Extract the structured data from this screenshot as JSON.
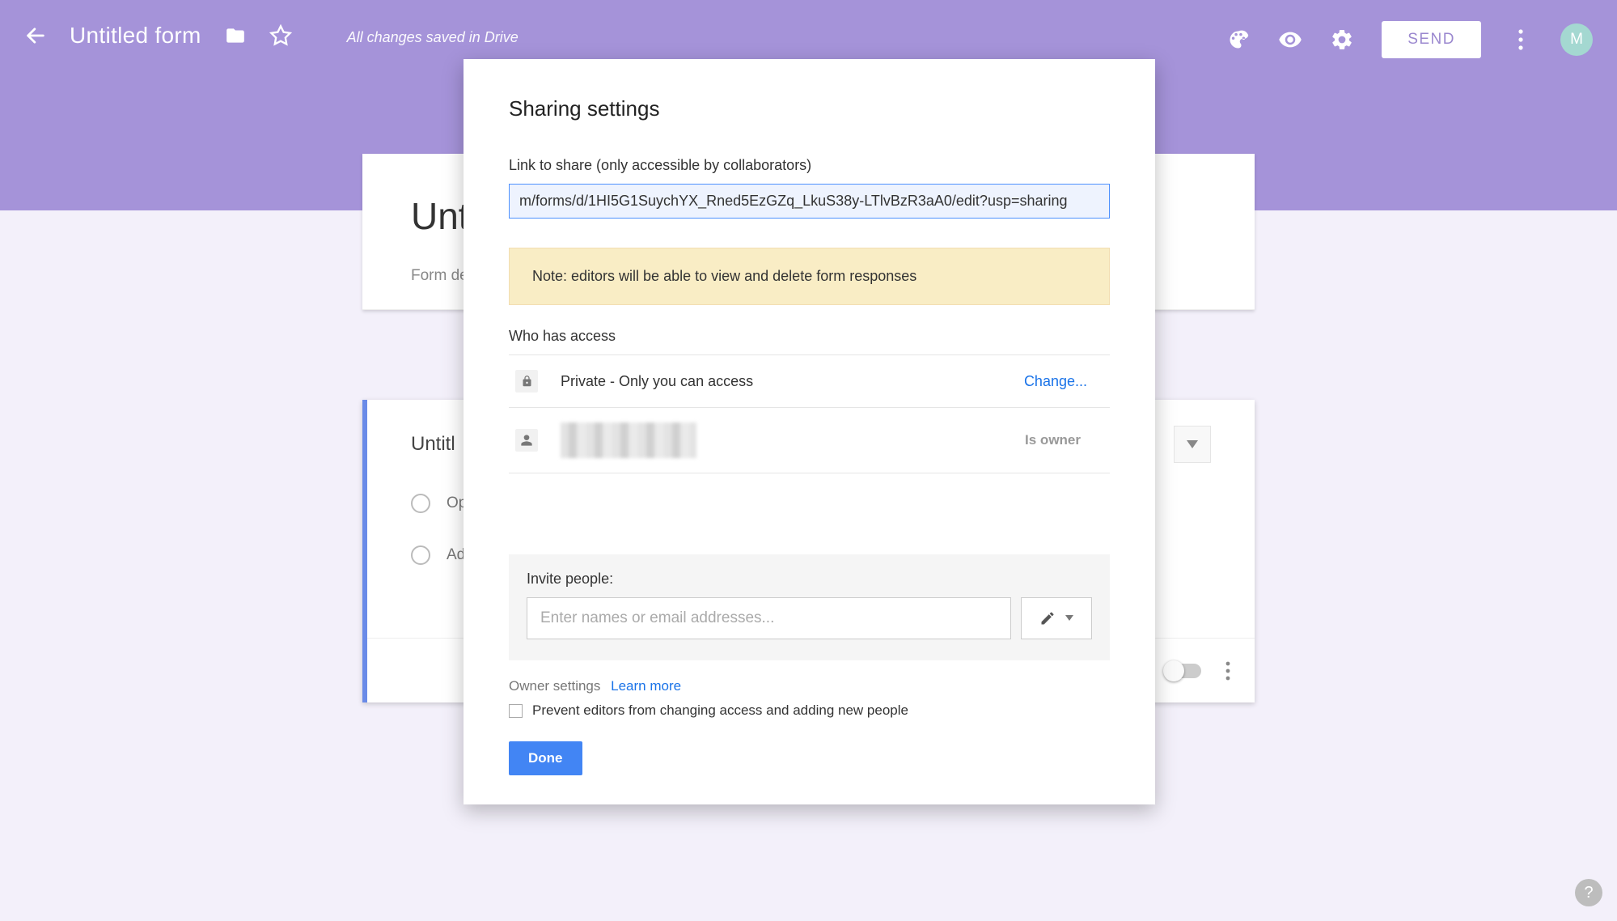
{
  "header": {
    "title": "Untitled form",
    "status": "All changes saved in Drive",
    "send_label": "SEND",
    "avatar_initial": "M"
  },
  "form": {
    "title_partial": "Unt",
    "description": "Form de",
    "question_title_partial": "Untitl",
    "option1": "Op",
    "add_option": "Ad"
  },
  "modal": {
    "title": "Sharing settings",
    "link_label": "Link to share (only accessible by collaborators)",
    "link_value": "m/forms/d/1HI5G1SuychYX_Rned5EzGZq_LkuS38y-LTlvBzR3aA0/edit?usp=sharing",
    "note": "Note: editors will be able to view and delete form responses",
    "who_has_access": "Who has access",
    "private_text": "Private - Only you can access",
    "change_label": "Change...",
    "owner_role": "Is owner",
    "invite_label": "Invite people:",
    "invite_placeholder": "Enter names or email addresses...",
    "owner_settings_label": "Owner settings",
    "learn_more": "Learn more",
    "prevent_editors": "Prevent editors from changing access and adding new people",
    "done_label": "Done"
  },
  "help": {
    "label": "?"
  }
}
